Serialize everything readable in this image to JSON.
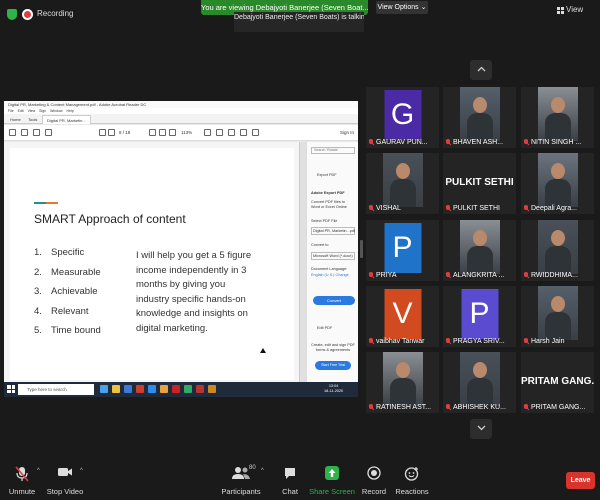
{
  "topbar": {
    "recording_label": "Recording",
    "share_banner": "You are viewing Debajyoti Banerjee (Seven Boat...'s screen",
    "talking": "Debajyoti Banerjee (Seven Boats) is talking...",
    "view_options": "View Options ⌄",
    "view": "View"
  },
  "acrobat": {
    "title": "Digital PR, Marketing & Content Management.pdf - Adobe Acrobat Reader DC",
    "menu": "File Edit View Sign Window Help",
    "tabs": [
      "Home",
      "Tools",
      "Digital PR, Marketin..."
    ],
    "sign_in": "Sign In",
    "page_indicator": "8 / 18",
    "zoom": "113%",
    "right_pane": {
      "search": "Search 'Rotate'",
      "export_pdf": "Export PDF",
      "product": "Adobe Export PDF",
      "desc": "Convert PDF files to Word or Excel Online",
      "select_file": "Select PDF File",
      "file_name": "Digital PR, Marketin...pdf",
      "convert_to": "Convert to",
      "format": "Microsoft Word (*.docx)",
      "doc_lang": "Document Language:",
      "lang_value": "English (U.S.) Change",
      "convert": "Convert",
      "edit_pdf": "Edit PDF",
      "promo": "Create, edit and sign PDF forms & agreements",
      "trial": "Start Free Trial"
    },
    "slide": {
      "title": "SMART Approach of content",
      "list": [
        {
          "n": "1.",
          "t": "Specific"
        },
        {
          "n": "2.",
          "t": "Measurable"
        },
        {
          "n": "3.",
          "t": "Achievable"
        },
        {
          "n": "4.",
          "t": "Relevant"
        },
        {
          "n": "5.",
          "t": "Time bound"
        }
      ],
      "body": "I will help you get a 5 figure income independently in 3 months by giving you industry specific hands-on knowledge and insights on digital marketing."
    },
    "taskbar": {
      "search": "Type here to search",
      "time": "13:04",
      "date": "18-11-2020"
    }
  },
  "participants": [
    {
      "name": "GAURAV PUN...",
      "initial": "G",
      "color": "#4b2aa6"
    },
    {
      "name": "BHAVEN ASH...",
      "video": true
    },
    {
      "name": "NITIN SINGH ...",
      "video": true
    },
    {
      "name": "VISHAL",
      "video": true
    },
    {
      "name": "PULKIT SETHI",
      "display": "PULKIT SETHI"
    },
    {
      "name": "Deepali Agra...",
      "video": true
    },
    {
      "name": "PRIYA",
      "initial": "P",
      "color": "#1f73c9"
    },
    {
      "name": "ALANGKRITA ...",
      "video": true
    },
    {
      "name": "RWIDDHIMA...",
      "video": true
    },
    {
      "name": "vaibhav Tanwar",
      "initial": "V",
      "color": "#d24a1f"
    },
    {
      "name": "PRAGYA SRIV...",
      "initial": "P",
      "color": "#5a4bd1"
    },
    {
      "name": "Harsh Jain",
      "video": true
    },
    {
      "name": "RATINESH AST...",
      "video": true
    },
    {
      "name": "ABHISHEK KU...",
      "video": true
    },
    {
      "name": "PRITAM GANG...",
      "display": "PRITAM GANG..."
    }
  ],
  "controls": {
    "unmute": "Unmute",
    "stop_video": "Stop Video",
    "participants": "Participants",
    "participants_count": "80",
    "chat": "Chat",
    "share_screen": "Share Screen",
    "record": "Record",
    "reactions": "Reactions",
    "leave": "Leave"
  },
  "colors": {
    "share_green": "#2db34a",
    "leave_red": "#d9342b",
    "slide_teal": "#2b8c8c",
    "slide_orange": "#e07a2e"
  }
}
